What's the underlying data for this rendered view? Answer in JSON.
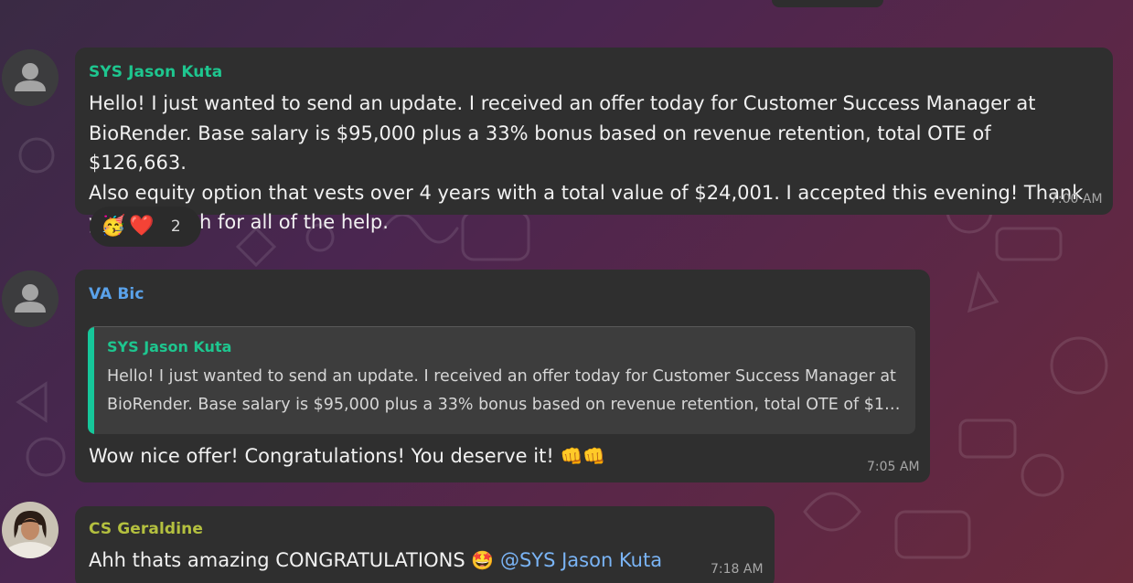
{
  "colors": {
    "green_name": "#1ec68f",
    "blue_name": "#5aa2ea",
    "olive_name": "#b4c03f",
    "bubble_bg": "#2f2f2f",
    "mention": "#7ab4f5"
  },
  "messages": [
    {
      "sender": "SYS Jason Kuta",
      "avatar_icon": "user-placeholder-icon",
      "lines": [
        "Hello! I just wanted to send an update. I received an offer today for Customer Success Manager at",
        "BioRender. Base salary is $95,000 plus a 33% bonus based on revenue retention, total OTE of $126,663.",
        "Also equity option that vests over 4 years with a total value of $24,001. I accepted this evening! Thank",
        "you so much for all of the help."
      ],
      "time": "7:00 AM",
      "reactions": {
        "emojis": [
          "🥳",
          "❤️"
        ],
        "count": "2"
      }
    },
    {
      "sender": "VA Bic",
      "avatar_icon": "user-placeholder-icon",
      "reply_to": {
        "sender": "SYS Jason Kuta",
        "lines": [
          "Hello! I just wanted to send an update. I received an offer today for Customer Success Manager at",
          "BioRender. Base salary is $95,000 plus a 33% bonus based on revenue retention, total OTE of $1…"
        ]
      },
      "text": "Wow nice offer! Congratulations! You deserve it!",
      "emoji": "👊👊",
      "time": "7:05 AM"
    },
    {
      "sender": "CS Geraldine",
      "avatar_icon": "user-photo-avatar",
      "text": "Ahh thats amazing CONGRATULATIONS",
      "emoji": "🤩",
      "mention": "@SYS Jason Kuta",
      "time": "7:18 AM"
    }
  ]
}
